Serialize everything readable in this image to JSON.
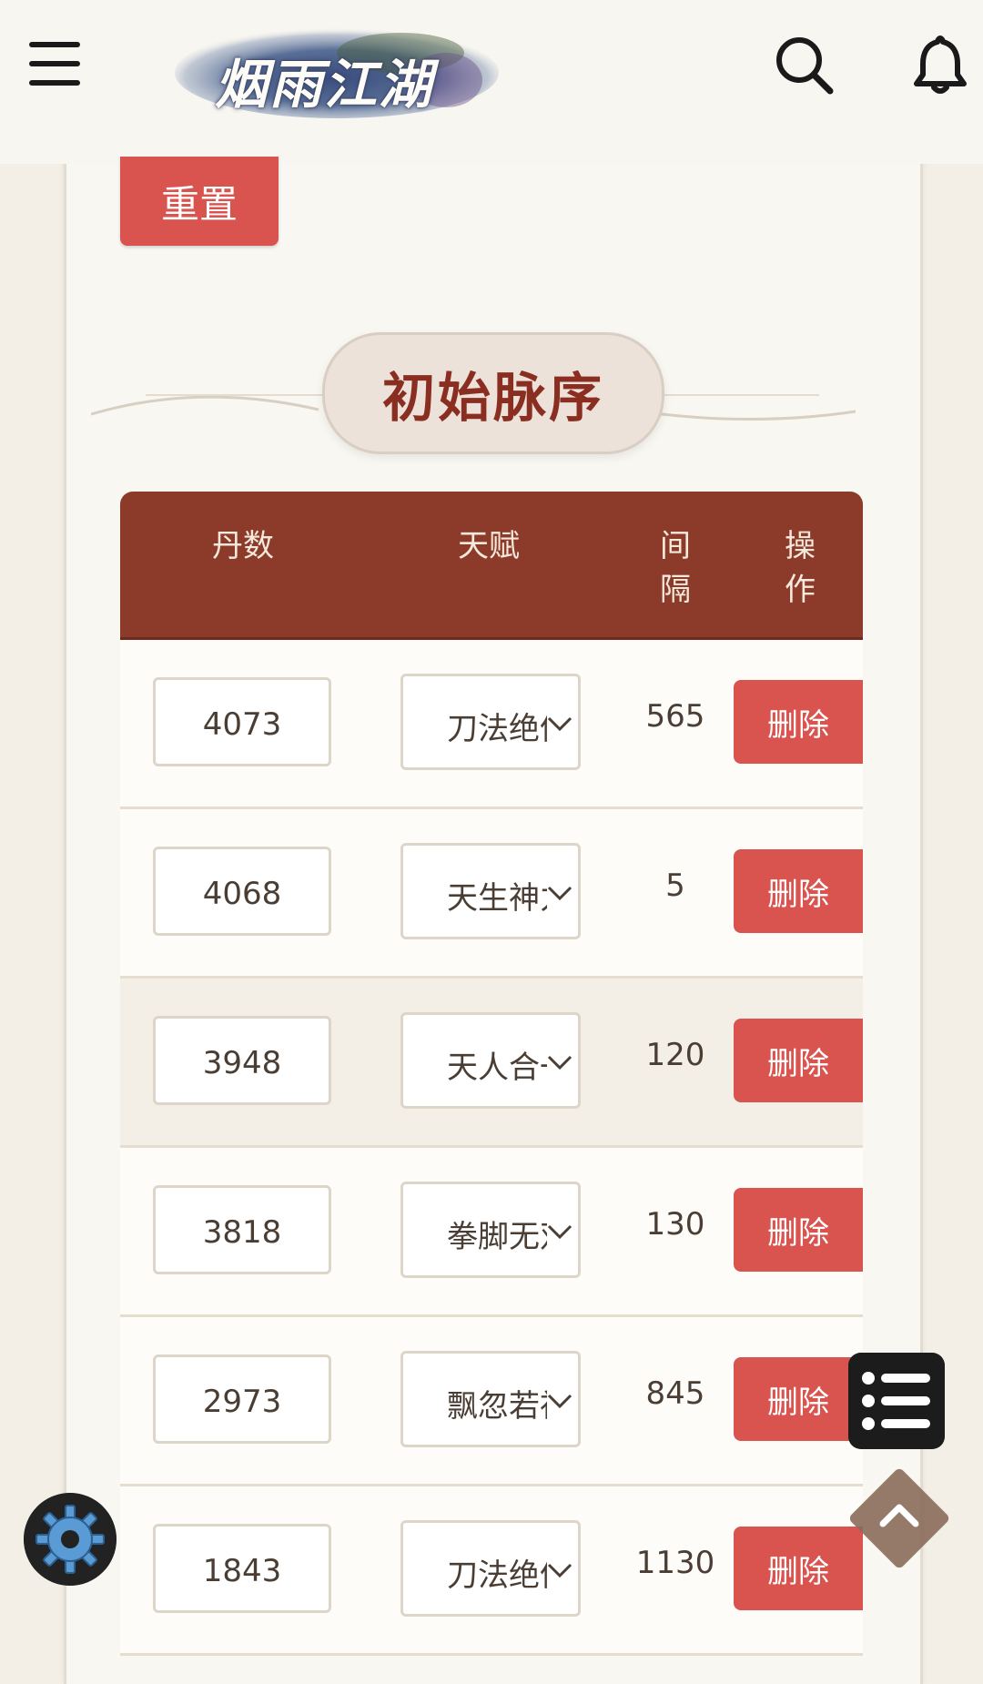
{
  "header": {
    "logo_text": "烟雨江湖",
    "menu_icon": "menu-icon",
    "search_icon": "search-icon",
    "bell_icon": "bell-icon"
  },
  "actions": {
    "reset_label": "重置"
  },
  "section": {
    "title": "初始脉序"
  },
  "table": {
    "headers": {
      "dan": "丹数",
      "talent": "天赋",
      "interval": "间隔",
      "op": "操作"
    },
    "rows": [
      {
        "dan": "4073",
        "talent": "刀法绝伦",
        "interval": "565",
        "action": "删除"
      },
      {
        "dan": "4068",
        "talent": "天生神力",
        "interval": "5",
        "action": "删除"
      },
      {
        "dan": "3948",
        "talent": "天人合一",
        "interval": "120",
        "action": "删除"
      },
      {
        "dan": "3818",
        "talent": "拳脚无双",
        "interval": "130",
        "action": "删除"
      },
      {
        "dan": "2973",
        "talent": "飘忽若神",
        "interval": "845",
        "action": "删除"
      },
      {
        "dan": "1843",
        "talent": "刀法绝伦",
        "interval": "1130",
        "action": "删除"
      }
    ]
  },
  "floating": {
    "list_icon": "list-icon",
    "up_icon": "chevron-up-icon",
    "gear_icon": "gear-icon"
  },
  "colors": {
    "accent_red": "#d9534f",
    "header_brown": "#8c3a2a",
    "title_red": "#8b2e22"
  }
}
